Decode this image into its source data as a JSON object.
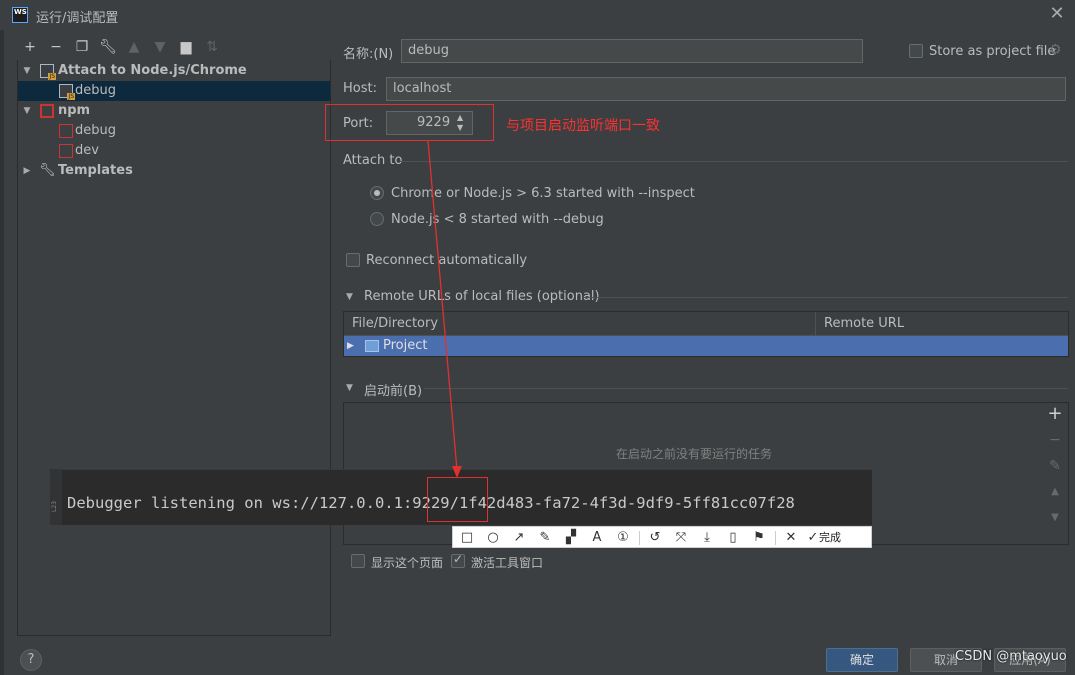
{
  "window": {
    "title": "运行/调试配置",
    "app_icon": "WS"
  },
  "toolbar": {
    "icons": [
      "plus-icon",
      "minus-icon",
      "copy-icon",
      "wrench-icon",
      "arrow-up-icon",
      "arrow-down-icon",
      "folder-icon",
      "sort-icon"
    ]
  },
  "tree": {
    "attach_group": "Attach to Node.js/Chrome",
    "attach_debug": "debug",
    "npm_group": "npm",
    "npm_debug": "debug",
    "npm_dev": "dev",
    "templates": "Templates"
  },
  "form": {
    "name_label": "名称:(N)",
    "name_value": "debug",
    "store_label": "Store as project file",
    "host_label": "Host:",
    "host_value": "localhost",
    "port_label": "Port:",
    "port_value": "9229",
    "port_note": "与项目启动监听端口一致",
    "attach_to_label": "Attach to",
    "radio_inspect": "Chrome or Node.js > 6.3 started with --inspect",
    "radio_debug": "Node.js < 8 started with --debug",
    "reconnect_label": "Reconnect automatically",
    "remote_urls_label": "Remote URLs of local files (optional)",
    "col_file": "File/Directory",
    "col_remote": "Remote URL",
    "row_project": "Project",
    "before_launch_label": "启动前(B)",
    "before_launch_empty": "在启动之前没有要运行的任务",
    "show_page_label": "显示这个页面",
    "activate_tool_label": "激活工具窗口"
  },
  "terminal": {
    "prefix": "Debugger listening on ws://127.0.0.1:",
    "port": "9229",
    "suffix": "/1f42d483-fa72-4f3d-9df9-5ff81cc07f28",
    "gutter": "L23"
  },
  "snip_toolbar": {
    "done_label": "完成"
  },
  "buttons": {
    "ok": "确定",
    "cancel": "取消",
    "apply": "应用(A)",
    "help": "?"
  },
  "watermark": "CSDN @mtaoyuo",
  "colors": {
    "accent_red": "#e03030",
    "selection": "#4b6eaf",
    "primary_button": "#365880"
  }
}
